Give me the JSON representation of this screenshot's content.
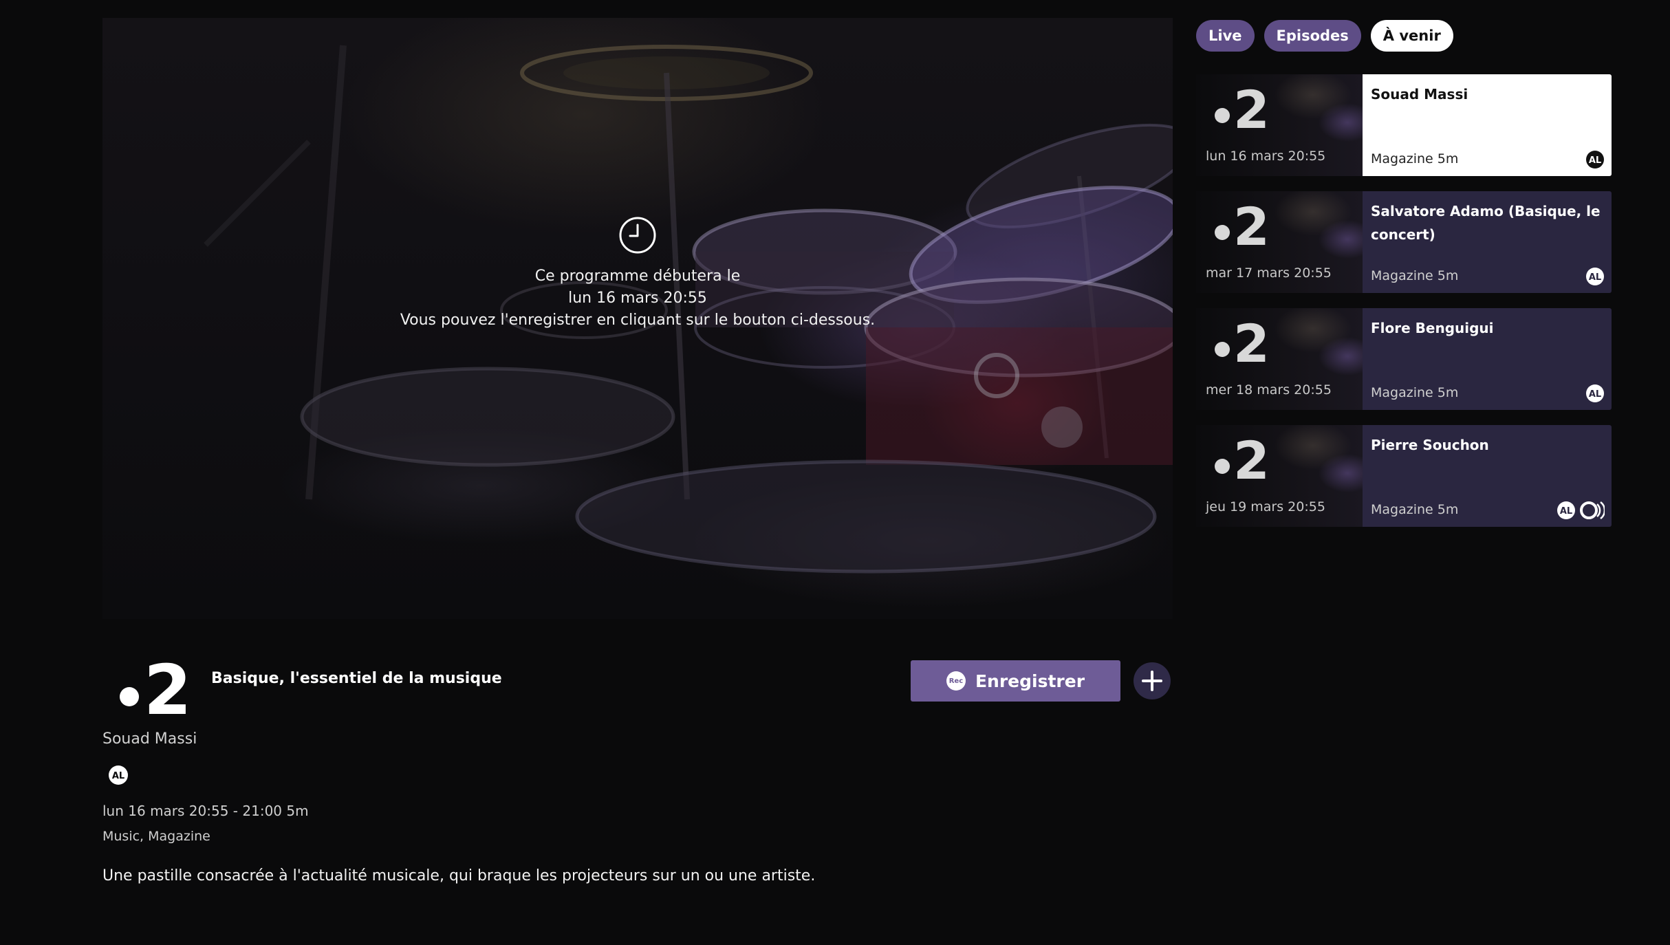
{
  "player": {
    "overlay_line1": "Ce programme débutera le",
    "overlay_line2": "lun 16 mars 20:55",
    "overlay_line3": "Vous pouvez l'enregistrer en cliquant sur le bouton ci-dessous.",
    "icon": "clock-icon"
  },
  "tabs": [
    {
      "label": "Live",
      "active": false
    },
    {
      "label": "Episodes",
      "active": false
    },
    {
      "label": "À venir",
      "active": true
    }
  ],
  "cards": [
    {
      "title": "Souad Massi",
      "date": "lun 16 mars 20:55",
      "meta": "Magazine 5m",
      "badges": [
        "AL"
      ],
      "selected": true
    },
    {
      "title": "Salvatore Adamo (Basique, le concert)",
      "date": "mar 17 mars 20:55",
      "meta": "Magazine 5m",
      "badges": [
        "AL"
      ],
      "selected": false
    },
    {
      "title": "Flore Benguigui",
      "date": "mer 18 mars 20:55",
      "meta": "Magazine 5m",
      "badges": [
        "AL"
      ],
      "selected": false
    },
    {
      "title": "Pierre Souchon",
      "date": "jeu 19 mars 20:55",
      "meta": "Magazine 5m",
      "badges": [
        "AL",
        "audio-description"
      ],
      "selected": false
    }
  ],
  "details": {
    "channel_logo": "2",
    "show_title": "Basique, l'essentiel de la musique",
    "record_label": "Enregistrer",
    "rec_icon_label": "Rec",
    "episode_name": "Souad Massi",
    "badge": "AL",
    "schedule": "lun 16 mars 20:55 - 21:00 5m",
    "genres": "Music, Magazine",
    "description": "Une pastille consacrée à l'actualité musicale, qui braque les projecteurs sur un ou une artiste."
  },
  "colors": {
    "background": "#0a0a0b",
    "accent": "#6e5c97",
    "tab": "#5e4d86",
    "card": "#2a2640"
  }
}
